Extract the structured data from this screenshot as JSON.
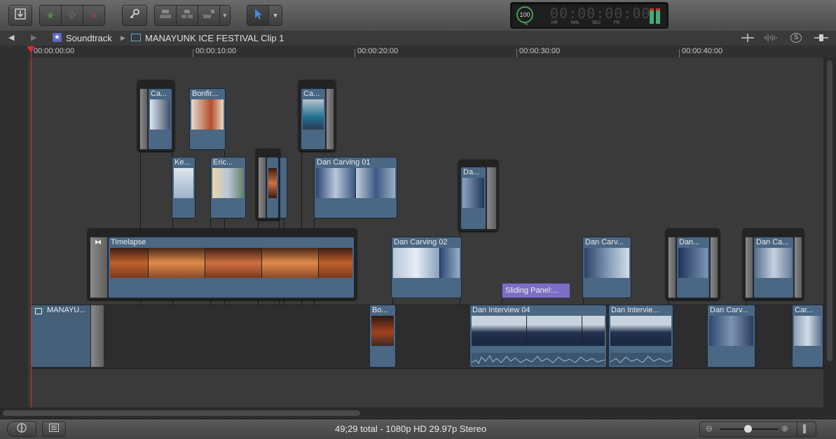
{
  "toolbar": {
    "import_icon": "import-down-icon",
    "favorite_icon": "star-filled-icon",
    "unrate_icon": "star-outline-icon",
    "reject_icon": "x-icon",
    "keyword_icon": "key-icon",
    "edit_icons": [
      "connect-clip-icon",
      "insert-clip-icon",
      "append-clip-icon",
      "overwrite-dropdown-icon"
    ],
    "tool_icon": "arrow-cursor-icon",
    "dashboard": {
      "percent": "100",
      "percent_unit": "%",
      "timecode": "00:00:00:00",
      "units": [
        "HR",
        "MIN",
        "SEC",
        "FR"
      ]
    }
  },
  "pathbar": {
    "back_icon": "back-arrow-icon",
    "forward_icon": "forward-arrow-icon",
    "project_name": "Soundtrack",
    "clip_name": "MANAYUNK ICE FESTIVAL Clip  1"
  },
  "ruler": {
    "labels": [
      "00:00:00:00",
      "00:00:10:00",
      "00:00:20:00",
      "00:00:30:00",
      "00:00:40:00"
    ]
  },
  "clips": {
    "primary": [
      {
        "name": "MANAYU..."
      },
      {
        "name": "Bo..."
      },
      {
        "name": "Dan Interview 04"
      },
      {
        "name": "Dan Intervie..."
      },
      {
        "name": "Dan Carv..."
      },
      {
        "name": "Car..."
      }
    ],
    "lane1": [
      {
        "name": "Timelapse"
      },
      {
        "name": "Dan Carving 02"
      },
      {
        "name": "Dan Carv..."
      },
      {
        "name": "Dan..."
      },
      {
        "name": "Dan Ca..."
      }
    ],
    "lane2": [
      {
        "name": "Ke..."
      },
      {
        "name": "Eric..."
      },
      {
        "name": "Dan Carving 01"
      },
      {
        "name": "Da..."
      }
    ],
    "lane3": [
      {
        "name": "Ca..."
      },
      {
        "name": "Bonfir..."
      },
      {
        "name": "Ca..."
      }
    ],
    "title_clip": "Sliding Panel:..."
  },
  "status": {
    "summary": "49;29 total - 1080p HD 29.97p Stereo"
  },
  "colors": {
    "clip": "#4a6784",
    "title_clip": "#7b6fc4",
    "playhead": "#d03030"
  }
}
